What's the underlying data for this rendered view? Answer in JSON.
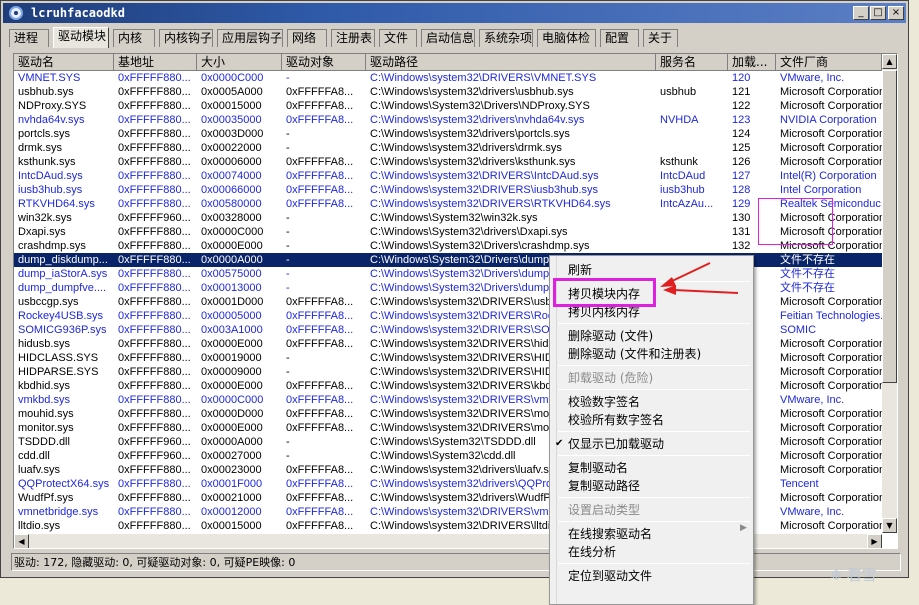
{
  "window": {
    "title": "lcruhfacaodkd",
    "min_glyph": "_",
    "max_glyph": "□",
    "close_glyph": "×"
  },
  "tabs": [
    "进程",
    "驱动模块",
    "内核",
    "内核钩子",
    "应用层钩子",
    "网络",
    "注册表",
    "文件",
    "启动信息",
    "系统杂项",
    "电脑体检",
    "配置",
    "关于"
  ],
  "active_tab": 1,
  "columns": [
    "驱动名",
    "基地址",
    "大小",
    "驱动对象",
    "驱动路径",
    "服务名",
    "加载...",
    "文件厂商"
  ],
  "rows": [
    {
      "c": [
        "VMNET.SYS",
        "0xFFFFF880...",
        "0x0000C000",
        "-",
        "C:\\Windows\\system32\\DRIVERS\\VMNET.SYS",
        "",
        "120",
        "VMware, Inc."
      ],
      "blue": true
    },
    {
      "c": [
        "usbhub.sys",
        "0xFFFFF880...",
        "0x0005A000",
        "0xFFFFFA8...",
        "C:\\Windows\\system32\\drivers\\usbhub.sys",
        "usbhub",
        "121",
        "Microsoft Corporation"
      ]
    },
    {
      "c": [
        "NDProxy.SYS",
        "0xFFFFF880...",
        "0x00015000",
        "0xFFFFFA8...",
        "C:\\Windows\\System32\\Drivers\\NDProxy.SYS",
        "",
        "122",
        "Microsoft Corporation"
      ]
    },
    {
      "c": [
        "nvhda64v.sys",
        "0xFFFFF880...",
        "0x00035000",
        "0xFFFFFA8...",
        "C:\\Windows\\system32\\drivers\\nvhda64v.sys",
        "NVHDA",
        "123",
        "NVIDIA Corporation"
      ],
      "blue": true
    },
    {
      "c": [
        "portcls.sys",
        "0xFFFFF880...",
        "0x0003D000",
        "-",
        "C:\\Windows\\system32\\drivers\\portcls.sys",
        "",
        "124",
        "Microsoft Corporation"
      ]
    },
    {
      "c": [
        "drmk.sys",
        "0xFFFFF880...",
        "0x00022000",
        "-",
        "C:\\Windows\\system32\\drivers\\drmk.sys",
        "",
        "125",
        "Microsoft Corporation"
      ]
    },
    {
      "c": [
        "ksthunk.sys",
        "0xFFFFF880...",
        "0x00006000",
        "0xFFFFFA8...",
        "C:\\Windows\\system32\\drivers\\ksthunk.sys",
        "ksthunk",
        "126",
        "Microsoft Corporation"
      ]
    },
    {
      "c": [
        "IntcDAud.sys",
        "0xFFFFF880...",
        "0x00074000",
        "0xFFFFFA8...",
        "C:\\Windows\\system32\\DRIVERS\\IntcDAud.sys",
        "IntcDAud",
        "127",
        "Intel(R) Corporation"
      ],
      "blue": true
    },
    {
      "c": [
        "iusb3hub.sys",
        "0xFFFFF880...",
        "0x00066000",
        "0xFFFFFA8...",
        "C:\\Windows\\system32\\DRIVERS\\iusb3hub.sys",
        "iusb3hub",
        "128",
        "Intel Corporation"
      ],
      "blue": true
    },
    {
      "c": [
        "RTKVHD64.sys",
        "0xFFFFF880...",
        "0x00580000",
        "0xFFFFFA8...",
        "C:\\Windows\\system32\\DRIVERS\\RTKVHD64.sys",
        "IntcAzAu...",
        "129",
        "Realtek Semiconduc..."
      ],
      "blue": true
    },
    {
      "c": [
        "win32k.sys",
        "0xFFFFF960...",
        "0x00328000",
        "-",
        "C:\\Windows\\System32\\win32k.sys",
        "",
        "130",
        "Microsoft Corporation"
      ]
    },
    {
      "c": [
        "Dxapi.sys",
        "0xFFFFF880...",
        "0x0000C000",
        "-",
        "C:\\Windows\\System32\\drivers\\Dxapi.sys",
        "",
        "131",
        "Microsoft Corporation"
      ]
    },
    {
      "c": [
        "crashdmp.sys",
        "0xFFFFF880...",
        "0x0000E000",
        "-",
        "C:\\Windows\\System32\\Drivers\\crashdmp.sys",
        "",
        "132",
        "Microsoft Corporation"
      ]
    },
    {
      "c": [
        "dump_diskdump...",
        "0xFFFFF880...",
        "0x0000A000",
        "-",
        "C:\\Windows\\System32\\Drivers\\dump_d...",
        "",
        "133",
        "文件不存在"
      ],
      "selected": true
    },
    {
      "c": [
        "dump_iaStorA.sys",
        "0xFFFFF880...",
        "0x00575000",
        "-",
        "C:\\Windows\\System32\\Drivers\\dump_i...",
        "",
        "",
        "文件不存在"
      ],
      "blue": true
    },
    {
      "c": [
        "dump_dumpfve....",
        "0xFFFFF880...",
        "0x00013000",
        "-",
        "C:\\Windows\\System32\\Drivers\\dump_d...",
        "",
        "",
        "文件不存在"
      ],
      "blue": true
    },
    {
      "c": [
        "usbccgp.sys",
        "0xFFFFF880...",
        "0x0001D000",
        "0xFFFFFA8...",
        "C:\\Windows\\system32\\DRIVERS\\usbccg...",
        "",
        "",
        "Microsoft Corporation"
      ]
    },
    {
      "c": [
        "Rockey4USB.sys",
        "0xFFFFF880...",
        "0x00005000",
        "0xFFFFFA8...",
        "C:\\Windows\\system32\\DRIVERS\\Rock...",
        "",
        "",
        "Feitian Technologies..."
      ],
      "blue": true
    },
    {
      "c": [
        "SOMICG936P.sys",
        "0xFFFFF880...",
        "0x003A1000",
        "0xFFFFFA8...",
        "C:\\Windows\\system32\\DRIVERS\\SOMI...",
        "",
        "",
        "SOMIC"
      ],
      "blue": true
    },
    {
      "c": [
        "hidusb.sys",
        "0xFFFFF880...",
        "0x0000E000",
        "0xFFFFFA8...",
        "C:\\Windows\\system32\\DRIVERS\\hidus...",
        "",
        "",
        "Microsoft Corporation"
      ]
    },
    {
      "c": [
        "HIDCLASS.SYS",
        "0xFFFFF880...",
        "0x00019000",
        "-",
        "C:\\Windows\\system32\\DRIVERS\\HIDC...",
        "",
        "",
        "Microsoft Corporation"
      ]
    },
    {
      "c": [
        "HIDPARSE.SYS",
        "0xFFFFF880...",
        "0x00009000",
        "-",
        "C:\\Windows\\system32\\DRIVERS\\HIDP...",
        "",
        "",
        "Microsoft Corporation"
      ]
    },
    {
      "c": [
        "kbdhid.sys",
        "0xFFFFF880...",
        "0x0000E000",
        "0xFFFFFA8...",
        "C:\\Windows\\system32\\DRIVERS\\kbdh...",
        "",
        "",
        "Microsoft Corporation"
      ]
    },
    {
      "c": [
        "vmkbd.sys",
        "0xFFFFF880...",
        "0x0000C000",
        "0xFFFFFA8...",
        "C:\\Windows\\system32\\DRIVERS\\vmkb...",
        "",
        "",
        "VMware, Inc."
      ],
      "blue": true
    },
    {
      "c": [
        "mouhid.sys",
        "0xFFFFF880...",
        "0x0000D000",
        "0xFFFFFA8...",
        "C:\\Windows\\system32\\DRIVERS\\mouh...",
        "",
        "",
        "Microsoft Corporation"
      ]
    },
    {
      "c": [
        "monitor.sys",
        "0xFFFFF880...",
        "0x0000E000",
        "0xFFFFFA8...",
        "C:\\Windows\\system32\\DRIVERS\\moni...",
        "",
        "",
        "Microsoft Corporation"
      ]
    },
    {
      "c": [
        "TSDDD.dll",
        "0xFFFFF960...",
        "0x0000A000",
        "-",
        "C:\\Windows\\System32\\TSDDD.dll",
        "",
        "",
        "Microsoft Corporation"
      ]
    },
    {
      "c": [
        "cdd.dll",
        "0xFFFFF960...",
        "0x00027000",
        "-",
        "C:\\Windows\\System32\\cdd.dll",
        "",
        "",
        "Microsoft Corporation"
      ]
    },
    {
      "c": [
        "luafv.sys",
        "0xFFFFF880...",
        "0x00023000",
        "0xFFFFFA8...",
        "C:\\Windows\\system32\\drivers\\luafv.s...",
        "",
        "",
        "Microsoft Corporation"
      ]
    },
    {
      "c": [
        "QQProtectX64.sys",
        "0xFFFFF880...",
        "0x0001F000",
        "0xFFFFFA8...",
        "C:\\Windows\\system32\\drivers\\QQPro...",
        "",
        "",
        "Tencent"
      ],
      "blue": true
    },
    {
      "c": [
        "WudfPf.sys",
        "0xFFFFF880...",
        "0x00021000",
        "0xFFFFFA8...",
        "C:\\Windows\\system32\\drivers\\WudfP...",
        "",
        "",
        "Microsoft Corporation"
      ]
    },
    {
      "c": [
        "vmnetbridge.sys",
        "0xFFFFF880...",
        "0x00012000",
        "0xFFFFFA8...",
        "C:\\Windows\\system32\\DRIVERS\\vmn...",
        "",
        "",
        "VMware, Inc."
      ],
      "blue": true
    },
    {
      "c": [
        "lltdio.sys",
        "0xFFFFF880...",
        "0x00015000",
        "0xFFFFFA8...",
        "C:\\Windows\\system32\\DRIVERS\\lltdio...",
        "",
        "",
        "Microsoft Corporation"
      ]
    }
  ],
  "context_menu": [
    {
      "label": "刷新"
    },
    {
      "sep": true
    },
    {
      "label": "拷贝模块内存",
      "highlighted": true
    },
    {
      "label": "拷贝内核内存"
    },
    {
      "sep": true
    },
    {
      "label": "删除驱动 (文件)"
    },
    {
      "label": "删除驱动 (文件和注册表)"
    },
    {
      "sep": true
    },
    {
      "label": "卸载驱动 (危险)",
      "disabled": true
    },
    {
      "sep": true
    },
    {
      "label": "校验数字签名"
    },
    {
      "label": "校验所有数字签名"
    },
    {
      "sep": true
    },
    {
      "label": "仅显示已加载驱动",
      "checked": true
    },
    {
      "sep": true
    },
    {
      "label": "复制驱动名"
    },
    {
      "label": "复制驱动路径"
    },
    {
      "sep": true
    },
    {
      "label": "设置启动类型",
      "disabled": true,
      "submenu": true
    },
    {
      "sep": true
    },
    {
      "label": "在线搜索驱动名"
    },
    {
      "label": "在线分析"
    },
    {
      "sep": true
    },
    {
      "label": "定位到驱动文件"
    }
  ],
  "statusbar": "驱动:  172, 隐藏驱动:  0, 可疑驱动对象:  0, 可疑PE映像:  0",
  "watermark": "❄ 看雪",
  "colors": {
    "highlight_box": "#e020e0",
    "arrow": "#e02020",
    "selected_row": "#0a246a",
    "unsigned_text": "#1f28d8"
  }
}
